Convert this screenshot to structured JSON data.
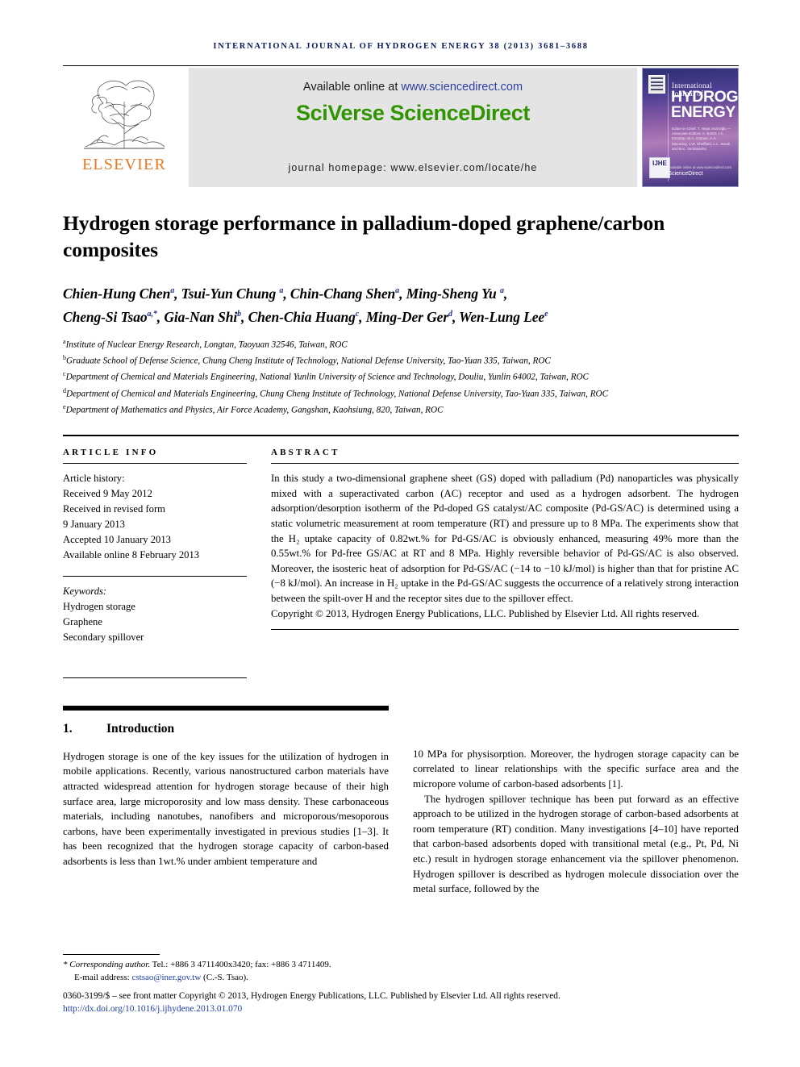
{
  "running_head": "International Journal of Hydrogen Energy 38 (2013) 3681–3688",
  "masthead": {
    "publisher_name": "ELSEVIER",
    "available_prefix": "Available online at ",
    "available_url": "www.sciencedirect.com",
    "platform_name": "SciVerse ScienceDirect",
    "homepage_line": "journal homepage: www.elsevier.com/locate/he",
    "cover": {
      "line_small": "International Journal of",
      "line_big_1": "HYDROGEN",
      "line_big_2": "ENERGY",
      "editors": "Editor-in-Chief: T. Nejat Veziroğlu — Associate Editors: A. Borkö, I.C. Escobar, M.A. Gomez, A.A. Macadoy, J.W. Sheffield, L.L. Sandi and B.K. Venkatesha",
      "imprint_badge": "IJHE",
      "sd_small": "Available online at www.sciencedirect.com",
      "sd_label": "ScienceDirect"
    }
  },
  "article": {
    "title": "Hydrogen storage performance in palladium-doped graphene/carbon composites",
    "authors_line_1": "Chien-Hung Chen a, Tsui-Yun Chung a, Chin-Chang Shen a, Ming-Sheng Yu a,",
    "authors_line_2": "Cheng-Si Tsao a,*, Gia-Nan Shi b, Chen-Chia Huang c, Ming-Der Ger d, Wen-Lung Lee e",
    "authors": [
      {
        "name": "Chien-Hung Chen",
        "sup": "a"
      },
      {
        "name": "Tsui-Yun Chung",
        "sup": "a"
      },
      {
        "name": "Chin-Chang Shen",
        "sup": "a"
      },
      {
        "name": "Ming-Sheng Yu",
        "sup": "a"
      },
      {
        "name": "Cheng-Si Tsao",
        "sup": "a,*"
      },
      {
        "name": "Gia-Nan Shi",
        "sup": "b"
      },
      {
        "name": "Chen-Chia Huang",
        "sup": "c"
      },
      {
        "name": "Ming-Der Ger",
        "sup": "d"
      },
      {
        "name": "Wen-Lung Lee",
        "sup": "e"
      }
    ],
    "affiliations": [
      {
        "sup": "a",
        "text": "Institute of Nuclear Energy Research, Longtan, Taoyuan 32546, Taiwan, ROC"
      },
      {
        "sup": "b",
        "text": "Graduate School of Defense Science, Chung Cheng Institute of Technology, National Defense University, Tao-Yuan 335, Taiwan, ROC"
      },
      {
        "sup": "c",
        "text": "Department of Chemical and Materials Engineering, National Yunlin University of Science and Technology, Douliu, Yunlin 64002, Taiwan, ROC"
      },
      {
        "sup": "d",
        "text": "Department of Chemical and Materials Engineering, Chung Cheng Institute of Technology, National Defense University, Tao-Yuan 335, Taiwan, ROC"
      },
      {
        "sup": "e",
        "text": "Department of Mathematics and Physics, Air Force Academy, Gangshan, Kaohsiung, 820, Taiwan, ROC"
      }
    ]
  },
  "article_info": {
    "heading": "ARTICLE INFO",
    "history_label": "Article history:",
    "history": [
      "Received 9 May 2012",
      "Received in revised form",
      "9 January 2013",
      "Accepted 10 January 2013",
      "Available online 8 February 2013"
    ],
    "keywords_label": "Keywords:",
    "keywords": [
      "Hydrogen storage",
      "Graphene",
      "Secondary spillover"
    ]
  },
  "abstract": {
    "heading": "ABSTRACT",
    "body": "In this study a two-dimensional graphene sheet (GS) doped with palladium (Pd) nanoparticles was physically mixed with a superactivated carbon (AC) receptor and used as a hydrogen adsorbent. The hydrogen adsorption/desorption isotherm of the Pd-doped GS catalyst/AC composite (Pd-GS/AC) is determined using a static volumetric measurement at room temperature (RT) and pressure up to 8 MPa. The experiments show that the H₂ uptake capacity of 0.82wt.% for Pd-GS/AC is obviously enhanced, measuring 49% more than the 0.55wt.% for Pd-free GS/AC at RT and 8 MPa. Highly reversible behavior of Pd-GS/AC is also observed. Moreover, the isosteric heat of adsorption for Pd-GS/AC (−14 to −10 kJ/mol) is higher than that for pristine AC (−8 kJ/mol). An increase in H₂ uptake in the Pd-GS/AC suggests the occurrence of a relatively strong interaction between the spilt-over H and the receptor sites due to the spillover effect.",
    "copyright": "Copyright © 2013, Hydrogen Energy Publications, LLC. Published by Elsevier Ltd. All rights reserved."
  },
  "section": {
    "number": "1.",
    "title": "Introduction",
    "left_paragraph": "Hydrogen storage is one of the key issues for the utilization of hydrogen in mobile applications. Recently, various nanostructured carbon materials have attracted widespread attention for hydrogen storage because of their high surface area, large microporosity and low mass density. These carbonaceous materials, including nanotubes, nanofibers and microporous/mesoporous carbons, have been experimentally investigated in previous studies [1–3]. It has been recognized that the hydrogen storage capacity of carbon-based adsorbents is less than 1wt.% under ambient temperature and",
    "right_paragraph_1": "10 MPa for physisorption. Moreover, the hydrogen storage capacity can be correlated to linear relationships with the specific surface area and the micropore volume of carbon-based adsorbents [1].",
    "right_paragraph_2": "The hydrogen spillover technique has been put forward as an effective approach to be utilized in the hydrogen storage of carbon-based adsorbents at room temperature (RT) condition. Many investigations [4–10] have reported that carbon-based adsorbents doped with transitional metal (e.g., Pt, Pd, Ni etc.) result in hydrogen storage enhancement via the spillover phenomenon. Hydrogen spillover is described as hydrogen molecule dissociation over the metal surface, followed by the"
  },
  "footer": {
    "corresponding_label": "Corresponding author.",
    "corresponding_contact": " Tel.: +886 3 4711400x3420; fax: +886 3 4711409.",
    "email_label": "E-mail address: ",
    "email": "cstsao@iner.gov.tw",
    "email_suffix": " (C.-S. Tsao).",
    "issn_line": "0360-3199/$ – see front matter Copyright © 2013, Hydrogen Energy Publications, LLC. Published by Elsevier Ltd. All rights reserved.",
    "doi": "http://dx.doi.org/10.1016/j.ijhydene.2013.01.070"
  }
}
